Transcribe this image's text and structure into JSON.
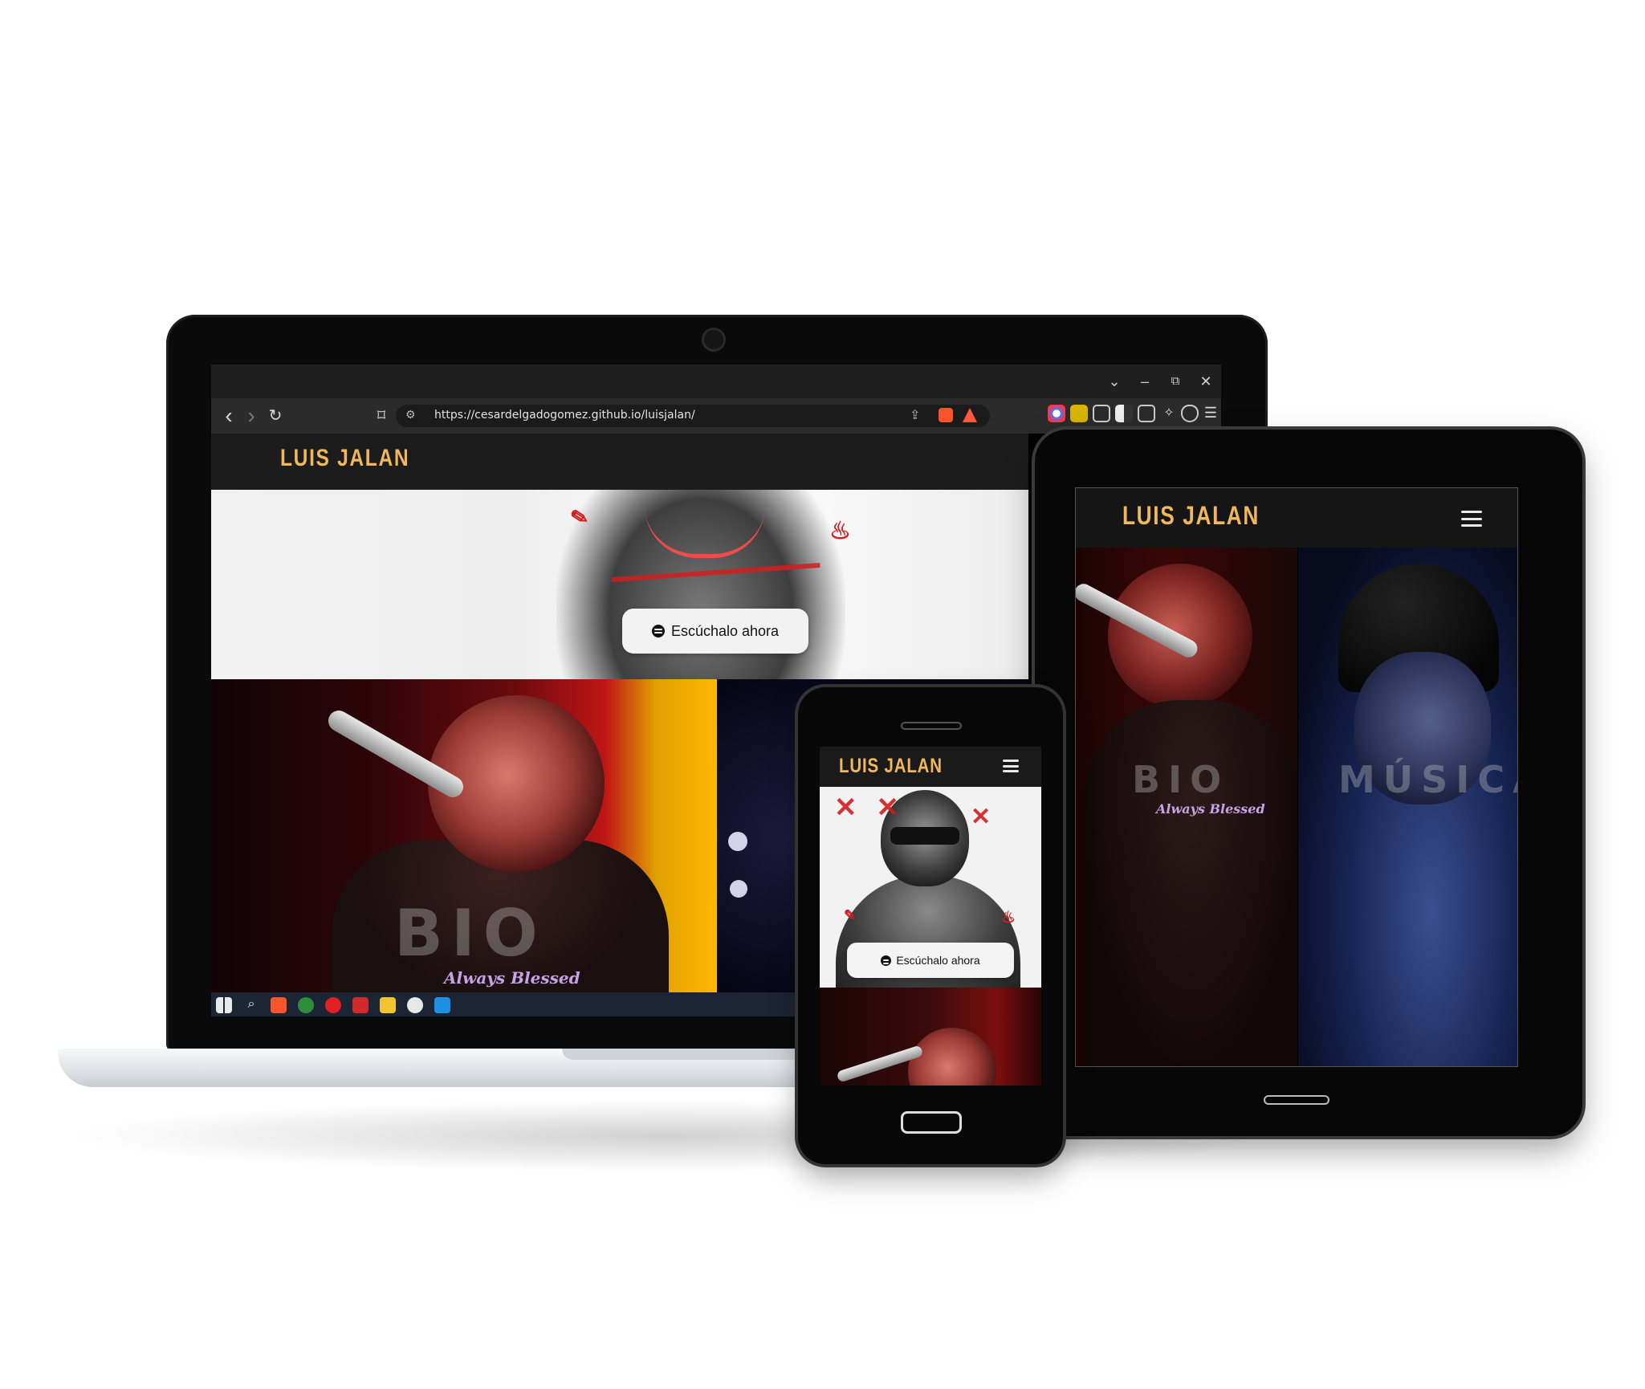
{
  "browser": {
    "url": "https://cesardelgadogomez.github.io/luisjalan/",
    "controls": {
      "dropdown": "⌄",
      "minimize": "–",
      "restore": "⧉",
      "close": "✕"
    },
    "nav": {
      "back": "‹",
      "forward": "›",
      "reload": "↻",
      "bookmark": "⌑",
      "site_info": "⚙"
    }
  },
  "site": {
    "logo": "LUIS JALAN",
    "cta_label": "Escúchalo ahora",
    "sections": {
      "bio": "BIO",
      "musica": "MÚSICA"
    },
    "bio_caption": "Always Blessed",
    "accent_color": "#f0b85a"
  },
  "icons": {
    "spotify": "spotify-icon",
    "menu": "hamburger-menu-icon"
  }
}
